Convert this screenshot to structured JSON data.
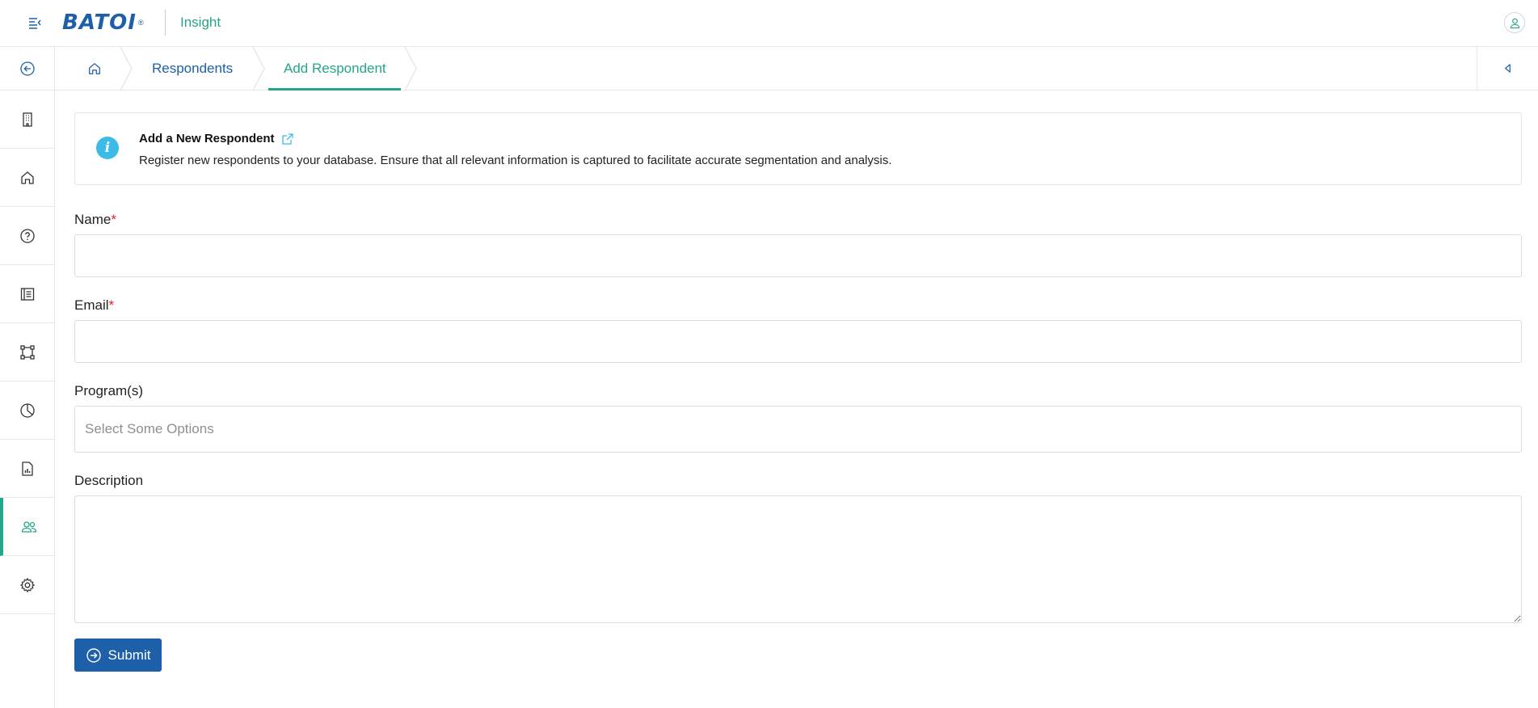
{
  "header": {
    "logo_text": "BATOI",
    "logo_reg": "®",
    "app_name": "Insight",
    "icons": {
      "menu": "menu-collapse-icon",
      "user": "user-icon"
    }
  },
  "sidebar": {
    "items": [
      {
        "name": "back",
        "icon": "arrow-left-circle-icon",
        "active": false
      },
      {
        "name": "organization",
        "icon": "building-icon",
        "active": false
      },
      {
        "name": "home",
        "icon": "home-icon",
        "active": false
      },
      {
        "name": "help",
        "icon": "question-circle-icon",
        "active": false
      },
      {
        "name": "surveys",
        "icon": "list-book-icon",
        "active": false
      },
      {
        "name": "workflow",
        "icon": "bounding-box-icon",
        "active": false
      },
      {
        "name": "analytics",
        "icon": "pie-chart-icon",
        "active": false
      },
      {
        "name": "reports",
        "icon": "report-file-icon",
        "active": false
      },
      {
        "name": "respondents",
        "icon": "users-icon",
        "active": true
      },
      {
        "name": "settings",
        "icon": "gear-icon",
        "active": false
      }
    ],
    "accent_color": "#25a58a"
  },
  "breadcrumb": {
    "home_icon": "home-icon",
    "items": [
      {
        "label": "Respondents"
      },
      {
        "label": "Add Respondent",
        "active": true
      }
    ],
    "collapse_icon": "caret-left-icon"
  },
  "info": {
    "title": "Add a New Respondent",
    "description": "Register new respondents to your database. Ensure that all relevant information is captured to facilitate accurate segmentation and analysis.",
    "icon": "info-icon",
    "link_icon": "external-link-icon"
  },
  "form": {
    "name_label": "Name",
    "email_label": "Email",
    "required_mark": "*",
    "programs_label": "Program(s)",
    "programs_placeholder": "Select Some Options",
    "description_label": "Description",
    "name_value": "",
    "email_value": "",
    "description_value": "",
    "submit_label": "Submit"
  },
  "colors": {
    "primary": "#1d5fa8",
    "accent": "#25a58a",
    "info": "#3bbbe8",
    "required": "#e0202a"
  }
}
